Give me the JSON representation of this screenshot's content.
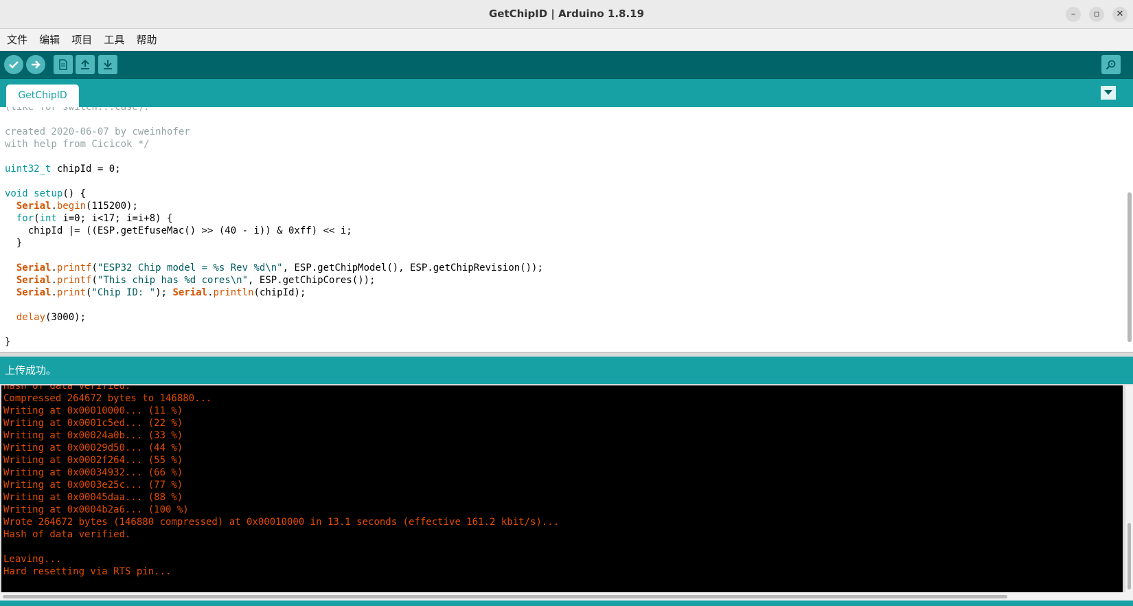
{
  "window": {
    "title": "GetChipID | Arduino 1.8.19",
    "minimize": "–",
    "maximize": "▫",
    "close": "✕"
  },
  "menu": [
    "文件",
    "编辑",
    "项目",
    "工具",
    "帮助"
  ],
  "toolbar": {
    "buttons": [
      "verify-icon",
      "upload-icon",
      "new-sketch-icon",
      "open-icon",
      "save-icon",
      "serial-monitor-icon"
    ]
  },
  "tabs": [
    {
      "label": "GetChipID"
    }
  ],
  "editor": {
    "lines": [
      [
        {
          "t": "(like for switch...case).",
          "c": "cm"
        }
      ],
      [],
      [
        {
          "t": "created 2020-06-07 by cweinhofer",
          "c": "cm"
        }
      ],
      [
        {
          "t": "with help from Cicicok */",
          "c": "cm"
        }
      ],
      [],
      [
        {
          "t": "uint32_t",
          "c": "kw"
        },
        {
          "t": " chipId = 0;"
        }
      ],
      [],
      [
        {
          "t": "void",
          "c": "kw"
        },
        {
          "t": " "
        },
        {
          "t": "setup",
          "c": "kw"
        },
        {
          "t": "() {"
        }
      ],
      [
        {
          "t": "  "
        },
        {
          "t": "Serial",
          "c": "cls"
        },
        {
          "t": "."
        },
        {
          "t": "begin",
          "c": "fn"
        },
        {
          "t": "(115200);"
        }
      ],
      [
        {
          "t": "  "
        },
        {
          "t": "for",
          "c": "kw"
        },
        {
          "t": "("
        },
        {
          "t": "int",
          "c": "kw"
        },
        {
          "t": " i=0; i<17; i=i+8) {"
        }
      ],
      [
        {
          "t": "    chipId |= ((ESP.getEfuseMac() >> (40 - i)) & 0xff) << i;"
        }
      ],
      [
        {
          "t": "  }"
        }
      ],
      [],
      [
        {
          "t": "  "
        },
        {
          "t": "Serial",
          "c": "cls"
        },
        {
          "t": "."
        },
        {
          "t": "printf",
          "c": "fn"
        },
        {
          "t": "("
        },
        {
          "t": "\"ESP32 Chip model = %s Rev %d\\n\"",
          "c": "st"
        },
        {
          "t": ", ESP.getChipModel(), ESP.getChipRevision());"
        }
      ],
      [
        {
          "t": "  "
        },
        {
          "t": "Serial",
          "c": "cls"
        },
        {
          "t": "."
        },
        {
          "t": "printf",
          "c": "fn"
        },
        {
          "t": "("
        },
        {
          "t": "\"This chip has %d cores\\n\"",
          "c": "st"
        },
        {
          "t": ", ESP.getChipCores());"
        }
      ],
      [
        {
          "t": "  "
        },
        {
          "t": "Serial",
          "c": "cls"
        },
        {
          "t": "."
        },
        {
          "t": "print",
          "c": "fn"
        },
        {
          "t": "("
        },
        {
          "t": "\"Chip ID: \"",
          "c": "st"
        },
        {
          "t": "); "
        },
        {
          "t": "Serial",
          "c": "cls"
        },
        {
          "t": "."
        },
        {
          "t": "println",
          "c": "fn"
        },
        {
          "t": "(chipId);"
        }
      ],
      [],
      [
        {
          "t": "  "
        },
        {
          "t": "delay",
          "c": "fn"
        },
        {
          "t": "(3000);"
        }
      ],
      [],
      [
        {
          "t": "}"
        }
      ]
    ]
  },
  "status": {
    "message": "上传成功。"
  },
  "console": {
    "lines": [
      "Hash of data verified.",
      "Compressed 264672 bytes to 146880...",
      "Writing at 0x00010000... (11 %)",
      "Writing at 0x0001c5ed... (22 %)",
      "Writing at 0x00024a0b... (33 %)",
      "Writing at 0x00029d50... (44 %)",
      "Writing at 0x0002f264... (55 %)",
      "Writing at 0x00034932... (66 %)",
      "Writing at 0x0003e25c... (77 %)",
      "Writing at 0x00045daa... (88 %)",
      "Writing at 0x0004b2a6... (100 %)",
      "Wrote 264672 bytes (146880 compressed) at 0x00010000 in 13.1 seconds (effective 161.2 kbit/s)...",
      "Hash of data verified.",
      "",
      "Leaving...",
      "Hard resetting via RTS pin..."
    ]
  },
  "colors": {
    "toolbar": "#006468",
    "tabbar": "#17a1a5",
    "console_text": "#e34c00"
  }
}
